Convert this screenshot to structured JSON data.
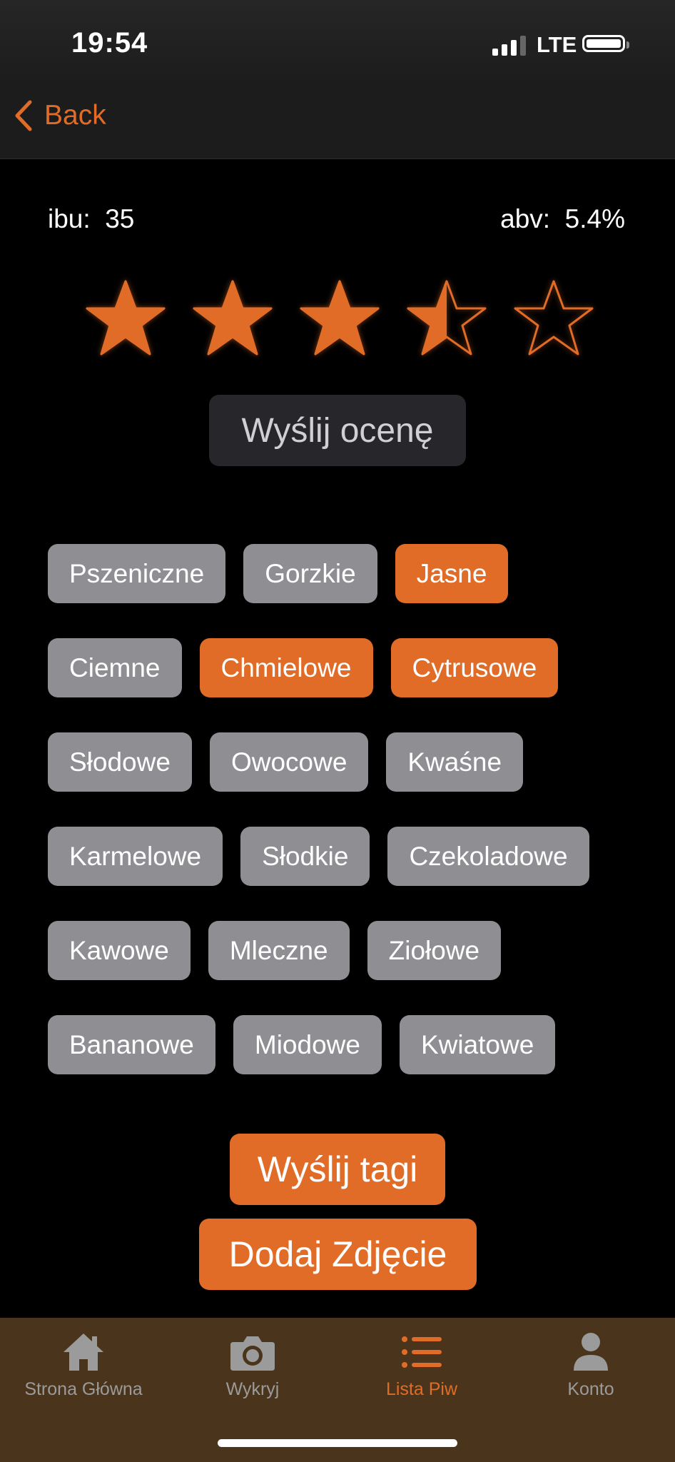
{
  "status_bar": {
    "time": "19:54",
    "network": "LTE"
  },
  "nav": {
    "back_label": "Back"
  },
  "beer": {
    "ibu_label": "ibu:",
    "ibu_value": "35",
    "abv_label": "abv:",
    "abv_value": "5.4%"
  },
  "rating": {
    "value": 3.5,
    "max": 5
  },
  "rate_button": {
    "label": "Wyślij ocenę"
  },
  "tags": [
    [
      {
        "label": "Pszeniczne",
        "selected": false
      },
      {
        "label": "Gorzkie",
        "selected": false
      },
      {
        "label": "Jasne",
        "selected": true
      }
    ],
    [
      {
        "label": "Ciemne",
        "selected": false
      },
      {
        "label": "Chmielowe",
        "selected": true
      },
      {
        "label": "Cytrusowe",
        "selected": true
      }
    ],
    [
      {
        "label": "Słodowe",
        "selected": false
      },
      {
        "label": "Owocowe",
        "selected": false
      },
      {
        "label": "Kwaśne",
        "selected": false
      }
    ],
    [
      {
        "label": "Karmelowe",
        "selected": false
      },
      {
        "label": "Słodkie",
        "selected": false
      },
      {
        "label": "Czekoladowe",
        "selected": false
      }
    ],
    [
      {
        "label": "Kawowe",
        "selected": false
      },
      {
        "label": "Mleczne",
        "selected": false
      },
      {
        "label": "Ziołowe",
        "selected": false
      }
    ],
    [
      {
        "label": "Bananowe",
        "selected": false
      },
      {
        "label": "Miodowe",
        "selected": false
      },
      {
        "label": "Kwiatowe",
        "selected": false
      }
    ]
  ],
  "buttons": {
    "send_tags": "Wyślij tagi",
    "add_photo": "Dodaj Zdjęcie"
  },
  "tab_bar": {
    "items": [
      {
        "label": "Strona Główna",
        "icon": "home-icon",
        "active": false
      },
      {
        "label": "Wykryj",
        "icon": "camera-icon",
        "active": false
      },
      {
        "label": "Lista Piw",
        "icon": "list-icon",
        "active": true
      },
      {
        "label": "Konto",
        "icon": "person-icon",
        "active": false
      }
    ]
  },
  "colors": {
    "accent": "#e06c27",
    "tag_default": "#8e8e93",
    "tab_bar_bg": "#4a341b"
  }
}
